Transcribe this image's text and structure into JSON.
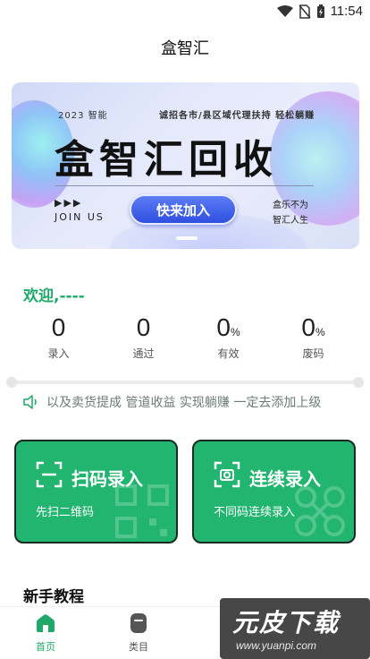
{
  "status_bar": {
    "time": "11:54"
  },
  "app": {
    "title": "盒智汇"
  },
  "banner": {
    "year_text": "2023 智能",
    "slogan": "诚招各市/县区域代理扶持  轻松躺赚",
    "headline": "盒智汇回收",
    "arrows": "▶▶▶",
    "join_text": "JOIN US",
    "button_label": "快来加入",
    "side_line1": "盒乐不为",
    "side_line2": "智汇人生"
  },
  "welcome": {
    "text": "欢迎,----"
  },
  "stats": [
    {
      "value": "0",
      "unit": "",
      "label": "录入"
    },
    {
      "value": "0",
      "unit": "",
      "label": "通过"
    },
    {
      "value": "0",
      "unit": "%",
      "label": "有效"
    },
    {
      "value": "0",
      "unit": "%",
      "label": "废码"
    }
  ],
  "notice": {
    "text": "以及卖货提成 管道收益 实现躺赚 一定去添加上级"
  },
  "actions": {
    "scan": {
      "title": "扫码录入",
      "subtitle": "先扫二维码"
    },
    "continuous": {
      "title": "连续录入",
      "subtitle": "不同码连续录入"
    }
  },
  "section": {
    "title": "新手教程"
  },
  "tabs": [
    {
      "label": "首页",
      "active": true
    },
    {
      "label": "类目",
      "active": false
    }
  ],
  "watermark": {
    "big": "元皮下载",
    "small": "www.yuanpi.com"
  },
  "colors": {
    "accent": "#22b56f",
    "welcome": "#1fa86a",
    "banner_button": "#3a5ae8"
  }
}
